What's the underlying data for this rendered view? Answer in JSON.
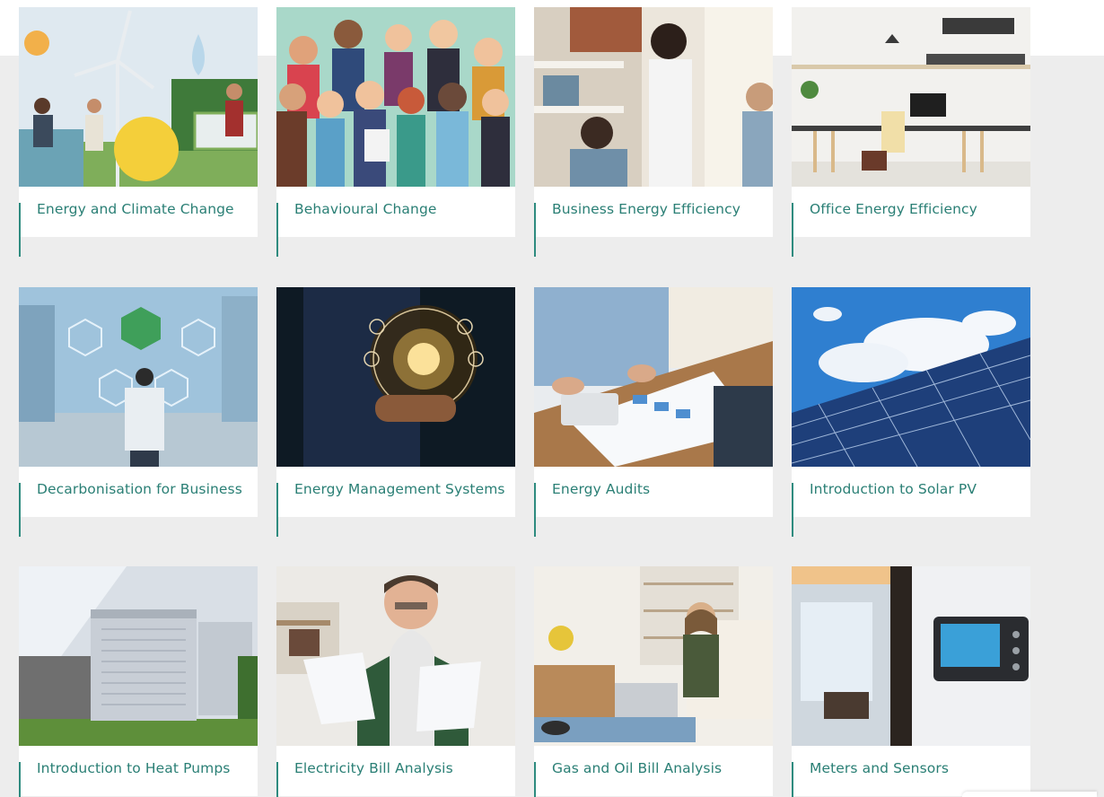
{
  "courses": [
    {
      "title": "Energy and Climate Change",
      "thumb_icon": "energy-climate-image"
    },
    {
      "title": "Behavioural Change",
      "thumb_icon": "behaviour-people-image"
    },
    {
      "title": "Business Energy Efficiency",
      "thumb_icon": "business-meeting-image"
    },
    {
      "title": "Office Energy Efficiency",
      "thumb_icon": "office-desk-image"
    },
    {
      "title": "Decarbonisation for Business",
      "thumb_icon": "co2-city-image"
    },
    {
      "title": "Energy Management Systems",
      "thumb_icon": "bulb-network-image"
    },
    {
      "title": "Energy Audits",
      "thumb_icon": "paperwork-audit-image"
    },
    {
      "title": "Introduction to Solar PV",
      "thumb_icon": "solar-panels-image"
    },
    {
      "title": "Introduction to Heat Pumps",
      "thumb_icon": "heat-pump-units-image"
    },
    {
      "title": "Electricity Bill Analysis",
      "thumb_icon": "man-reading-bill-image"
    },
    {
      "title": "Gas and Oil Bill Analysis",
      "thumb_icon": "woman-laptop-image"
    },
    {
      "title": "Meters and Sensors",
      "thumb_icon": "wall-thermostat-image"
    }
  ],
  "colors": {
    "accent": "#2e8b7f",
    "label_text": "#2a7f75",
    "background": "#ededed"
  }
}
